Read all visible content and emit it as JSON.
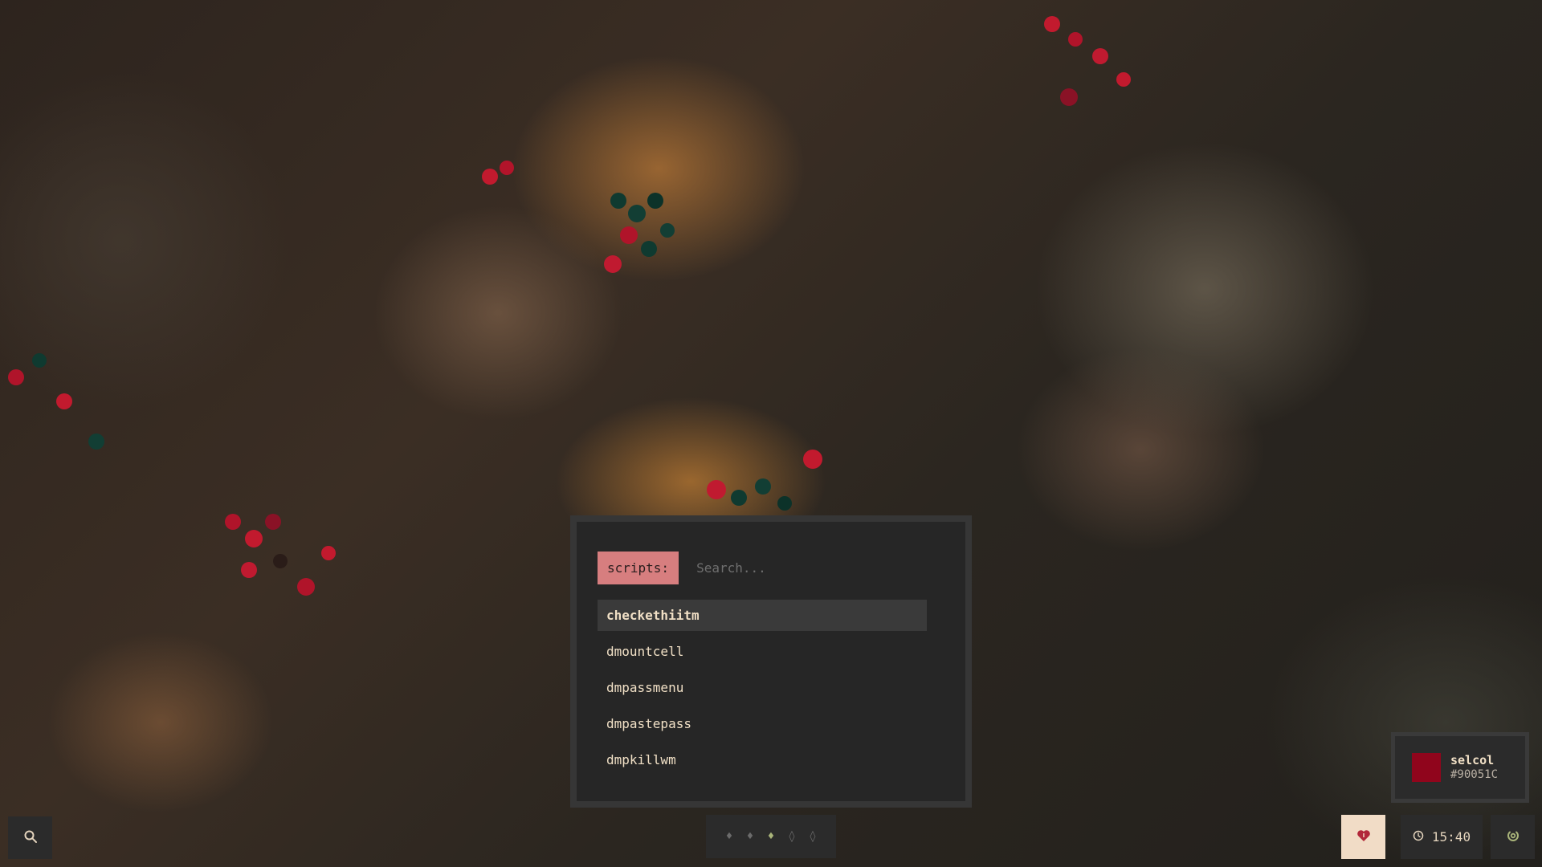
{
  "launcher": {
    "prompt_label": "scripts:",
    "search_placeholder": "Search...",
    "results": [
      "checkethiitm",
      "dmountcell",
      "dmpassmenu",
      "dmpastepass",
      "dmpkillwm"
    ],
    "selected_index": 0
  },
  "workspaces": {
    "items": [
      {
        "glyph": "♦",
        "active": false
      },
      {
        "glyph": "♦",
        "active": false
      },
      {
        "glyph": "♦",
        "active": true
      },
      {
        "glyph": "◊",
        "active": false
      },
      {
        "glyph": "◊",
        "active": false
      }
    ]
  },
  "color_picker": {
    "name": "selcol",
    "hex": "#90051C",
    "swatch_color": "#90051c"
  },
  "clock": {
    "time": "15:40"
  },
  "colors": {
    "accent": "#d77e7f",
    "panel_bg": "#262626",
    "bar_bg": "#2b2b2b",
    "text_light": "#f1e0c6",
    "heart_bg": "#f1dcc6",
    "heart_color": "#b2283a",
    "workspace_active": "#a9b47a"
  },
  "icons": {
    "search": "search-icon",
    "heart": "heart-icon",
    "clock": "clock-icon",
    "power": "power-icon"
  }
}
